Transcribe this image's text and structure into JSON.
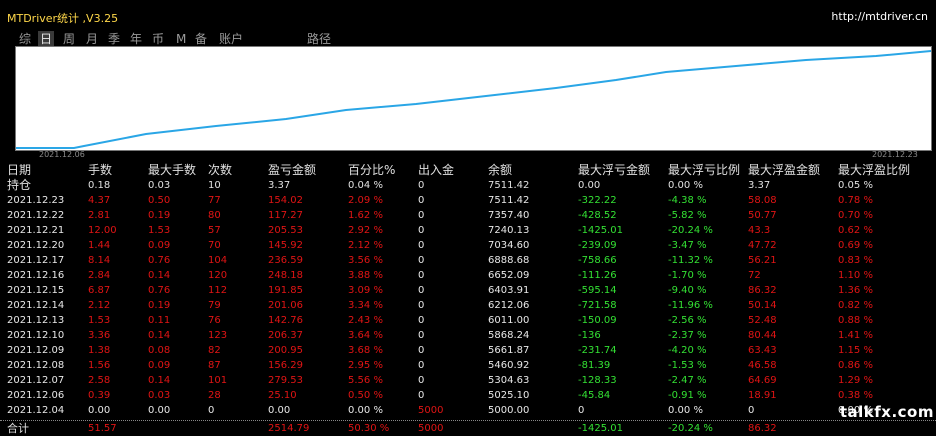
{
  "app": {
    "title": "MTDriver统计 ,V3.25",
    "url": "http://mtdriver.cn"
  },
  "tabs": [
    {
      "label": "综"
    },
    {
      "label": "日",
      "active": true
    },
    {
      "label": "周"
    },
    {
      "label": "月"
    },
    {
      "label": "季"
    },
    {
      "label": "年"
    },
    {
      "label": "币"
    },
    {
      "label": "M"
    },
    {
      "label": "备"
    },
    {
      "label": "账户"
    },
    {
      "label": "路径"
    }
  ],
  "chart": {
    "start_date": "2021.12.06",
    "end_date": "2021.12.23",
    "line_color": "#2aa6e6"
  },
  "table": {
    "headers": [
      "日期",
      "手数",
      "最大手数",
      "次数",
      "盈亏金额",
      "百分比%",
      "出入金",
      "余额",
      "最大浮亏金额",
      "最大浮亏比例",
      "最大浮盈金额",
      "最大浮盈比例"
    ],
    "holding": [
      "持仓",
      "0.18",
      "0.03",
      "10",
      "3.37",
      "0.04 %",
      "0",
      "7511.42",
      "0.00",
      "0.00 %",
      "3.37",
      "0.05 %"
    ],
    "rows": [
      [
        "2021.12.23",
        "4.37",
        "0.50",
        "77",
        "154.02",
        "2.09 %",
        "0",
        "7511.42",
        "-322.22",
        "-4.38 %",
        "58.08",
        "0.78 %"
      ],
      [
        "2021.12.22",
        "2.81",
        "0.19",
        "80",
        "117.27",
        "1.62 %",
        "0",
        "7357.40",
        "-428.52",
        "-5.82 %",
        "50.77",
        "0.70 %"
      ],
      [
        "2021.12.21",
        "12.00",
        "1.53",
        "57",
        "205.53",
        "2.92 %",
        "0",
        "7240.13",
        "-1425.01",
        "-20.24 %",
        "43.3",
        "0.62 %"
      ],
      [
        "2021.12.20",
        "1.44",
        "0.09",
        "70",
        "145.92",
        "2.12 %",
        "0",
        "7034.60",
        "-239.09",
        "-3.47 %",
        "47.72",
        "0.69 %"
      ],
      [
        "2021.12.17",
        "8.14",
        "0.76",
        "104",
        "236.59",
        "3.56 %",
        "0",
        "6888.68",
        "-758.66",
        "-11.32 %",
        "56.21",
        "0.83 %"
      ],
      [
        "2021.12.16",
        "2.84",
        "0.14",
        "120",
        "248.18",
        "3.88 %",
        "0",
        "6652.09",
        "-111.26",
        "-1.70 %",
        "72",
        "1.10 %"
      ],
      [
        "2021.12.15",
        "6.87",
        "0.76",
        "112",
        "191.85",
        "3.09 %",
        "0",
        "6403.91",
        "-595.14",
        "-9.40 %",
        "86.32",
        "1.36 %"
      ],
      [
        "2021.12.14",
        "2.12",
        "0.19",
        "79",
        "201.06",
        "3.34 %",
        "0",
        "6212.06",
        "-721.58",
        "-11.96 %",
        "50.14",
        "0.82 %"
      ],
      [
        "2021.12.13",
        "1.53",
        "0.11",
        "76",
        "142.76",
        "2.43 %",
        "0",
        "6011.00",
        "-150.09",
        "-2.56 %",
        "52.48",
        "0.88 %"
      ],
      [
        "2021.12.10",
        "3.36",
        "0.14",
        "123",
        "206.37",
        "3.64 %",
        "0",
        "5868.24",
        "-136",
        "-2.37 %",
        "80.44",
        "1.41 %"
      ],
      [
        "2021.12.09",
        "1.38",
        "0.08",
        "82",
        "200.95",
        "3.68 %",
        "0",
        "5661.87",
        "-231.74",
        "-4.20 %",
        "63.43",
        "1.15 %"
      ],
      [
        "2021.12.08",
        "1.56",
        "0.09",
        "87",
        "156.29",
        "2.95 %",
        "0",
        "5460.92",
        "-81.39",
        "-1.53 %",
        "46.58",
        "0.86 %"
      ],
      [
        "2021.12.07",
        "2.58",
        "0.14",
        "101",
        "279.53",
        "5.56 %",
        "0",
        "5304.63",
        "-128.33",
        "-2.47 %",
        "64.69",
        "1.29 %"
      ],
      [
        "2021.12.06",
        "0.39",
        "0.03",
        "28",
        "25.10",
        "0.50 %",
        "0",
        "5025.10",
        "-45.84",
        "-0.91 %",
        "18.91",
        "0.38 %"
      ],
      [
        "2021.12.04",
        "0.00",
        "0.00",
        "0",
        "0.00",
        "0.00 %",
        "5000",
        "5000.00",
        "0",
        "0.00 %",
        "0",
        "0.00 %"
      ]
    ],
    "total": [
      "合计",
      "51.57",
      "",
      "",
      "2514.79",
      "50.30 %",
      "5000",
      "",
      "-1425.01",
      "-20.24 %",
      "86.32",
      ""
    ]
  },
  "watermark": "talkfx.com"
}
